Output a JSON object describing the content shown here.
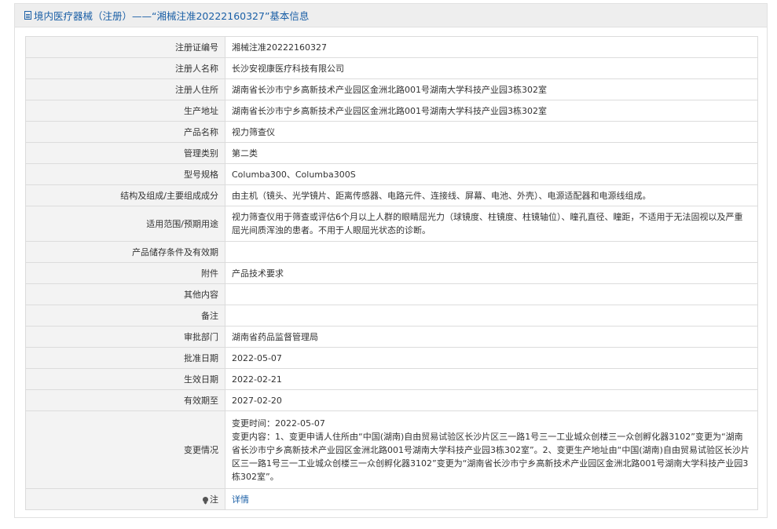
{
  "header": {
    "title": "境内医疗器械（注册）——“湘械注准20222160327”基本信息",
    "icon": "document-icon"
  },
  "rows": [
    {
      "label": "注册证编号",
      "value": "湘械注准20222160327"
    },
    {
      "label": "注册人名称",
      "value": "长沙安视康医疗科技有限公司"
    },
    {
      "label": "注册人住所",
      "value": "湖南省长沙市宁乡高新技术产业园区金洲北路001号湖南大学科技产业园3栋302室"
    },
    {
      "label": "生产地址",
      "value": "湖南省长沙市宁乡高新技术产业园区金洲北路001号湖南大学科技产业园3栋302室"
    },
    {
      "label": "产品名称",
      "value": "视力筛查仪"
    },
    {
      "label": "管理类别",
      "value": "第二类"
    },
    {
      "label": "型号规格",
      "value": "Columba300、Columba300S"
    },
    {
      "label": "结构及组成/主要组成成分",
      "value": "由主机（镜头、光学镜片、距离传感器、电路元件、连接线、屏幕、电池、外壳）、电源适配器和电源线组成。"
    },
    {
      "label": "适用范围/预期用途",
      "value": "视力筛查仪用于筛查或评估6个月以上人群的眼睛屈光力（球镜度、柱镜度、柱镜轴位）、瞳孔直径、瞳距，不适用于无法固视以及严重屈光间质浑浊的患者。不用于人眼屈光状态的诊断。"
    },
    {
      "label": "产品储存条件及有效期",
      "value": ""
    },
    {
      "label": "附件",
      "value": "产品技术要求"
    },
    {
      "label": "其他内容",
      "value": ""
    },
    {
      "label": "备注",
      "value": ""
    },
    {
      "label": "审批部门",
      "value": "湖南省药品监督管理局"
    },
    {
      "label": "批准日期",
      "value": "2022-05-07"
    },
    {
      "label": "生效日期",
      "value": "2022-02-21"
    },
    {
      "label": "有效期至",
      "value": "2027-02-20"
    }
  ],
  "change": {
    "label": "变更情况",
    "time": "变更时间：2022-05-07",
    "content": "变更内容：1、变更申请人住所由“中国(湖南)自由贸易试验区长沙片区三一路1号三一工业城众创楼三一众创孵化器3102”变更为“湖南省长沙市宁乡高新技术产业园区金洲北路001号湖南大学科技产业园3栋302室”。2、变更生产地址由“中国(湖南)自由贸易试验区长沙片区三一路1号三一工业城众创楼三一众创孵化器3102”变更为“湖南省长沙市宁乡高新技术产业园区金洲北路001号湖南大学科技产业园3栋302室”。"
  },
  "note": {
    "label": "注",
    "icon": "pin-icon",
    "link_text": "详情"
  },
  "colors": {
    "accent": "#1a5fa6",
    "label_bg": "#f3f3f3",
    "border": "#dcdcdc"
  }
}
